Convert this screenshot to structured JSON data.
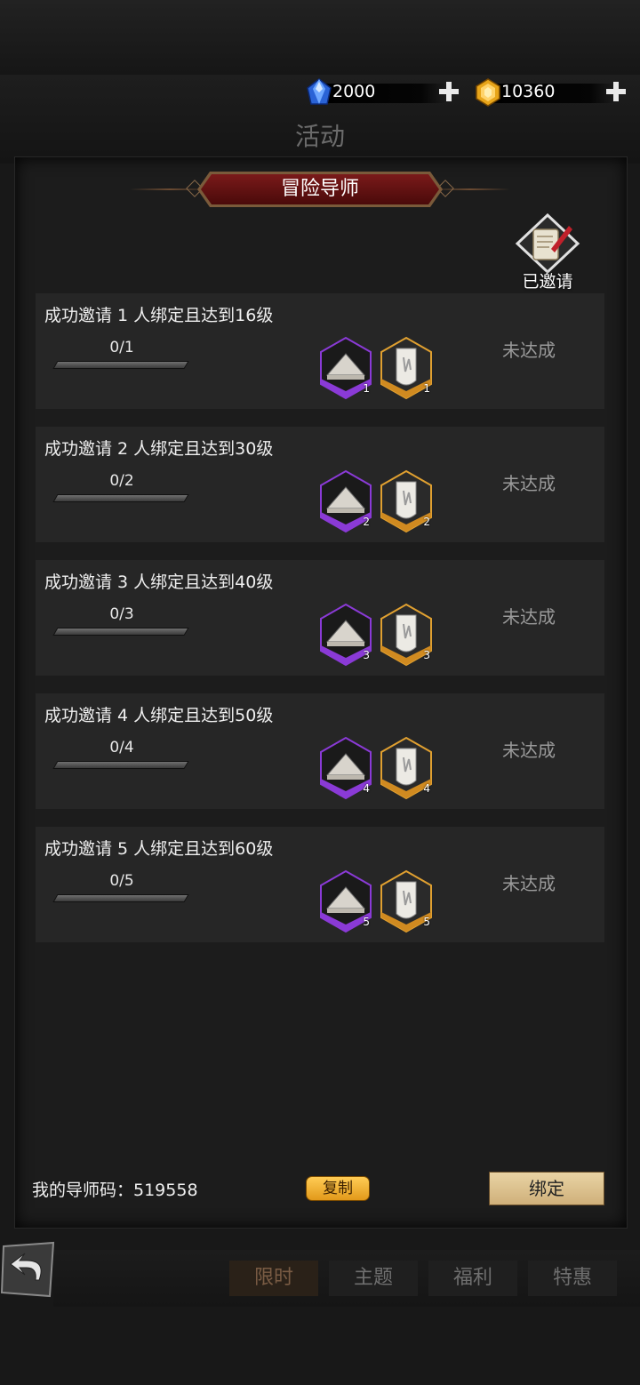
{
  "top": {
    "ghost_text": ""
  },
  "currency": {
    "gems": {
      "value": "2000",
      "icon": "blue-crystal-icon"
    },
    "gold": {
      "value": "10360",
      "icon": "gold-crystal-icon"
    }
  },
  "page_title": "活动",
  "banner_title": "冒险导师",
  "invited_label": "已邀请",
  "tasks": [
    {
      "title": "成功邀请 1 人绑定且达到16级",
      "progress": "0/1",
      "status": "未达成",
      "rewards": [
        "1",
        "1"
      ]
    },
    {
      "title": "成功邀请 2 人绑定且达到30级",
      "progress": "0/2",
      "status": "未达成",
      "rewards": [
        "2",
        "2"
      ]
    },
    {
      "title": "成功邀请 3 人绑定且达到40级",
      "progress": "0/3",
      "status": "未达成",
      "rewards": [
        "3",
        "3"
      ]
    },
    {
      "title": "成功邀请 4 人绑定且达到50级",
      "progress": "0/4",
      "status": "未达成",
      "rewards": [
        "4",
        "4"
      ]
    },
    {
      "title": "成功邀请 5 人绑定且达到60级",
      "progress": "0/5",
      "status": "未达成",
      "rewards": [
        "5",
        "5"
      ]
    }
  ],
  "footer": {
    "code_text": "我的导师码：519558",
    "copy_label": "复制",
    "bind_label": "绑定"
  },
  "tabs": [
    "限时",
    "主题",
    "福利",
    "特惠"
  ],
  "active_tab": 0
}
